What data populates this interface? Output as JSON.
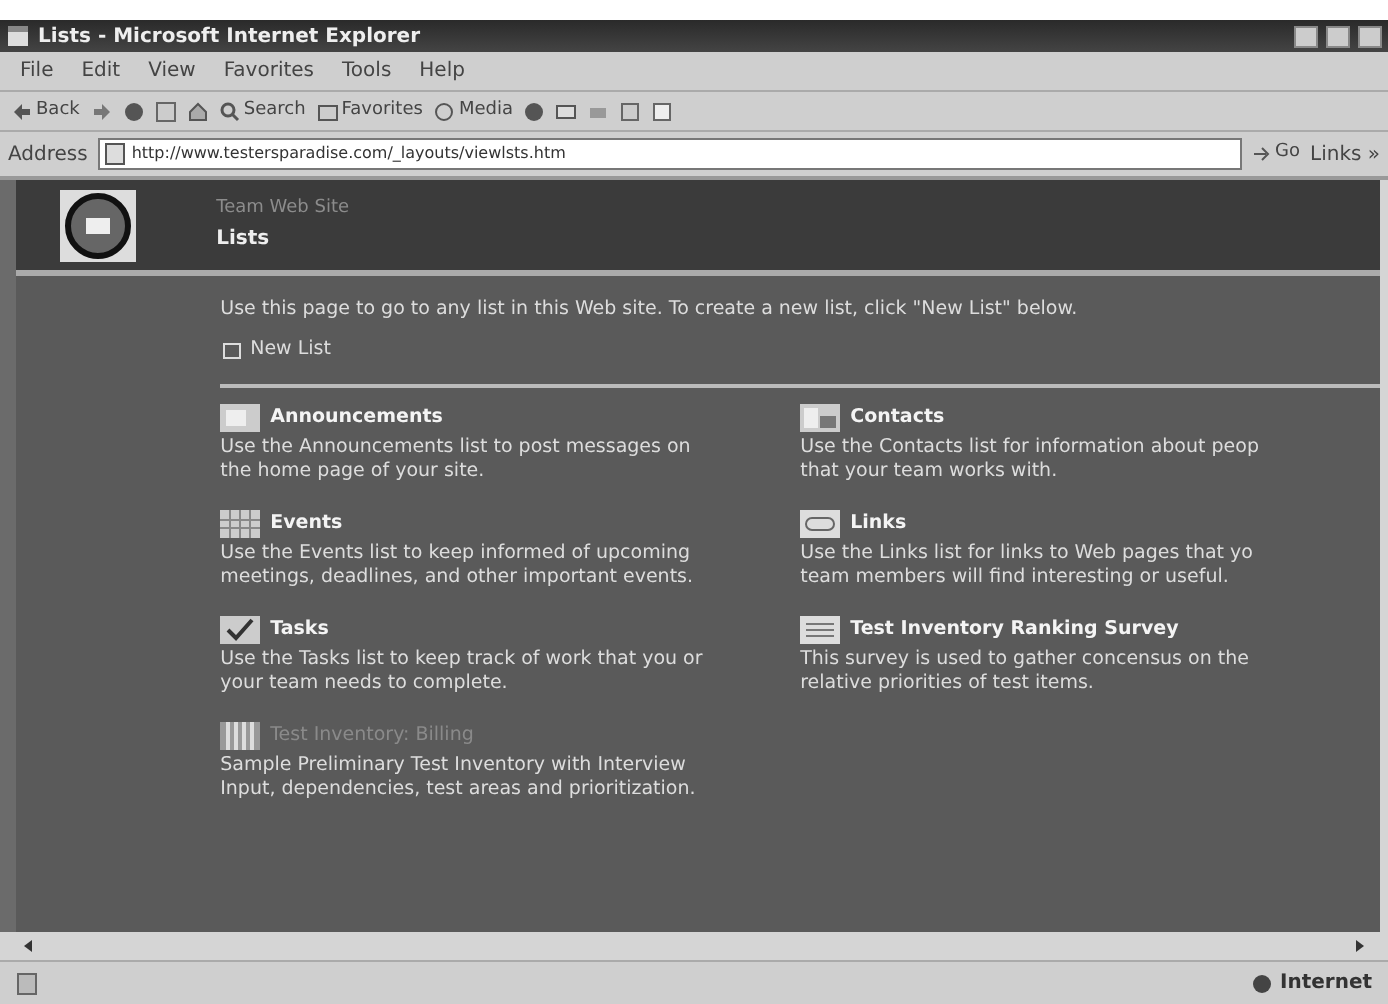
{
  "window": {
    "title": "Lists - Microsoft Internet Explorer"
  },
  "menu": [
    "File",
    "Edit",
    "View",
    "Favorites",
    "Tools",
    "Help"
  ],
  "toolbar": {
    "back": "Back",
    "search": "Search",
    "favorites": "Favorites",
    "media": "Media"
  },
  "address": {
    "label": "Address",
    "url": "http://www.testersparadise.com/_layouts/viewlsts.htm",
    "go": "Go",
    "links": "Links »"
  },
  "page": {
    "site": "Team Web Site",
    "title": "Lists",
    "intro": "Use this page to go to any list in this Web site. To create a new list, click \"New List\" below.",
    "new_list": "New List",
    "lists": [
      {
        "title": "Announcements",
        "dimmed": false,
        "lines": [
          "Use the Announcements list to post messages on",
          "the home page of your site."
        ]
      },
      {
        "title": "Contacts",
        "dimmed": false,
        "lines": [
          "Use the Contacts list for information about peop",
          "that your team works with."
        ]
      },
      {
        "title": "Events",
        "dimmed": false,
        "lines": [
          "Use the Events list to keep informed of upcoming",
          "meetings, deadlines, and other important events."
        ]
      },
      {
        "title": "Links",
        "dimmed": false,
        "lines": [
          "Use the Links list for links to Web pages that yo",
          "team members will find interesting or useful."
        ]
      },
      {
        "title": "Tasks",
        "dimmed": false,
        "lines": [
          "Use the Tasks list to keep track of work that you or",
          "your team needs to complete."
        ]
      },
      {
        "title": "Test Inventory Ranking Survey",
        "dimmed": false,
        "lines": [
          "This survey is used to gather concensus on the",
          "relative priorities of test items."
        ]
      },
      {
        "title": "Test Inventory: Billing",
        "dimmed": true,
        "lines": [
          "Sample Preliminary Test Inventory with Interview",
          "Input, dependencies, test areas and prioritization."
        ]
      }
    ]
  },
  "status_bar": {
    "zone": "Internet"
  }
}
